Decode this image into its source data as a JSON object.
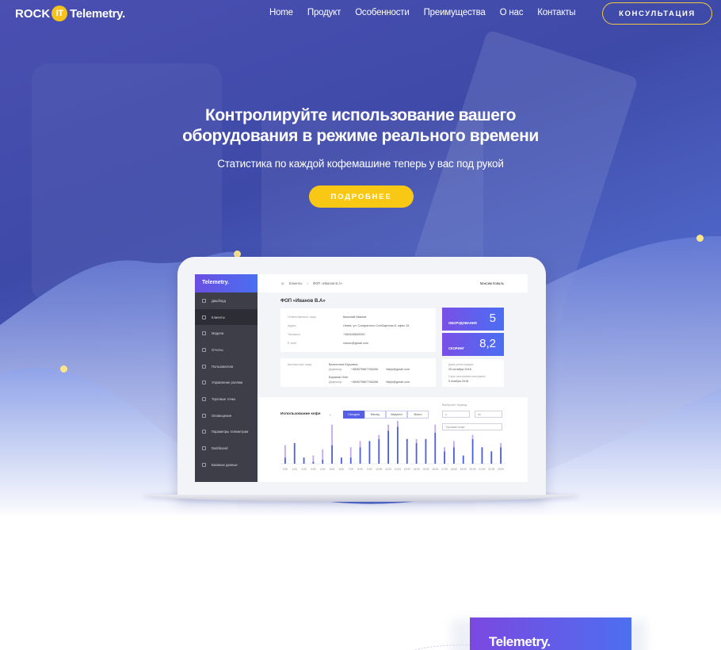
{
  "header": {
    "logo": {
      "rock": "ROCK",
      "it": "IT",
      "telemetry": "Telemetry."
    },
    "nav": [
      "Home",
      "Продукт",
      "Особенности",
      "Преимущества",
      "О нас",
      "Контакты"
    ],
    "cta": "КОНСУЛЬТАЦИЯ"
  },
  "hero": {
    "title_line1": "Контролируйте использование вашего",
    "title_line2": "оборудования в режиме реального времени",
    "subtitle": "Статистика по каждой кофемашине теперь у вас под рукой",
    "button": "ПОДРОБНЕЕ"
  },
  "dashboard": {
    "brand": "Telemetry.",
    "sidebar": [
      "Дашборд",
      "Клиенты",
      "Модели",
      "Отчеты",
      "Пользователи",
      "Управление ролями",
      "Торговые точки",
      "Оповещения",
      "Параметры телеметрии",
      "Dashboard",
      "Базовые данные"
    ],
    "breadcrumb": [
      "Клиенты",
      "ФОП «Иванов В.А»"
    ],
    "user": "Максим Коваль",
    "page_title": "ФОП «Иванов В.А»",
    "info": {
      "labels": [
        "Ответственное лицо",
        "Адрес",
        "Телефон",
        "E-mail"
      ],
      "values": [
        "Василий Иванов",
        "г.Киев, ул. Сагаратного Сообщества 8, офис 34",
        "+380445832062",
        "ivanov@gmail.com"
      ]
    },
    "contacts": {
      "label": "Контактные лица",
      "rows": [
        [
          "Валентина Юрьевна",
          "Директор",
          "+380675667765265",
          "Valyk@gmail.com"
        ],
        [
          "Баранов Олег",
          "Директор",
          "+380675667765268",
          "Valyk@gmail.com"
        ]
      ]
    },
    "kpi": [
      {
        "label": "ОБОРУДОВАНИЯ",
        "value": "5"
      },
      {
        "label": "СКОРИНГ",
        "value": "8,2"
      }
    ],
    "dates": [
      "Дата регистрации",
      "25 октября 2016",
      "Срок окончания контракта",
      "5 ноября 2018"
    ],
    "usage_title": "Использование кофе",
    "tabs": [
      "Сегодня",
      "Месяц",
      "Квартал",
      "Всего"
    ],
    "period_label": "Выберите период",
    "from": "с",
    "to": "по",
    "point_select": "Торговая точка",
    "chart_data": {
      "type": "bar",
      "categories": [
        "0:00",
        "1:00",
        "2:00",
        "3:00",
        "4:00",
        "5:00",
        "6:00",
        "7:00",
        "8:00",
        "9:00",
        "10:00",
        "11:00",
        "12:00",
        "13:00",
        "14:00",
        "15:00",
        "16:00",
        "17:00",
        "18:00",
        "19:00",
        "20:00",
        "21:00",
        "22:00",
        "23:00"
      ],
      "series": [
        {
          "values": [
            3,
            10,
            3,
            1,
            2,
            9,
            3,
            3,
            8,
            11,
            12,
            16,
            18,
            12,
            10,
            12,
            15,
            6,
            8,
            4,
            12,
            8,
            6,
            8
          ]
        },
        {
          "values": [
            6,
            0,
            0,
            3,
            5,
            10,
            0,
            5,
            3,
            0,
            2,
            3,
            3,
            0,
            2,
            0,
            4,
            2,
            3,
            0,
            2,
            0,
            0,
            2
          ]
        }
      ],
      "colors": [
        "#4a5ce6",
        "#c2a7ee"
      ]
    }
  },
  "bottom": {
    "brand": "Telemetry."
  }
}
